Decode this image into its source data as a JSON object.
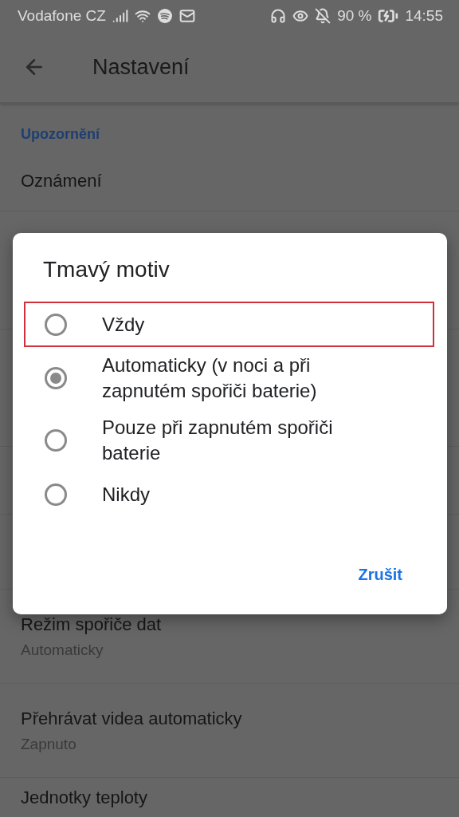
{
  "status_bar": {
    "carrier": "Vodafone CZ",
    "battery": "90 %",
    "time": "14:55"
  },
  "app_bar": {
    "title": "Nastavení"
  },
  "settings": {
    "section": "Upozornění",
    "top_items": [
      {
        "title": "Oznámení"
      }
    ],
    "bottom_items": [
      {
        "title": "Režim spořiče dat",
        "subtitle": "Automaticky"
      },
      {
        "title": "Přehrávat videa automaticky",
        "subtitle": "Zapnuto"
      },
      {
        "title": "Jednotky teploty"
      }
    ]
  },
  "dialog": {
    "title": "Tmavý motiv",
    "options": [
      {
        "label": "Vždy",
        "selected": false,
        "highlighted": true
      },
      {
        "label": "Automaticky (v noci a při zapnutém spořiči baterie)",
        "selected": true,
        "highlighted": false
      },
      {
        "label": "Pouze při zapnutém spořiči baterie",
        "selected": false,
        "highlighted": false
      },
      {
        "label": "Nikdy",
        "selected": false,
        "highlighted": false
      }
    ],
    "button": "Zrušit"
  }
}
